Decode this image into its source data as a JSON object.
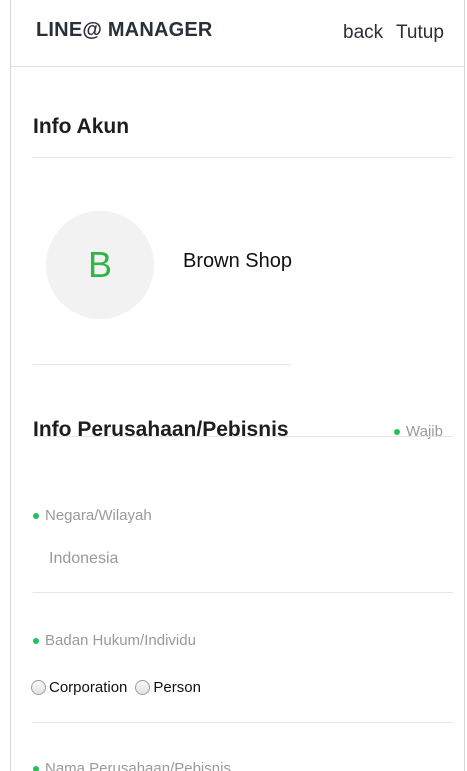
{
  "header": {
    "brand": "LINE@ MANAGER",
    "back_label": "back",
    "close_label": "Tutup"
  },
  "account": {
    "title": "Info Akun",
    "avatar_letter": "B",
    "shop_name": "Brown Shop"
  },
  "company": {
    "title": "Info Perusahaan/Pebisnis",
    "required_legend": "Wajib",
    "country_label": "Negara/Wilayah",
    "country_value": "Indonesia",
    "entity_label": "Badan Hukum/Individu",
    "entity_options": [
      "Corporation",
      "Person"
    ],
    "company_name_label": "Nama Perusahaan/Pebisnis"
  },
  "colors": {
    "accent": "#1fc35a",
    "avatar_letter": "#2fb54a"
  }
}
